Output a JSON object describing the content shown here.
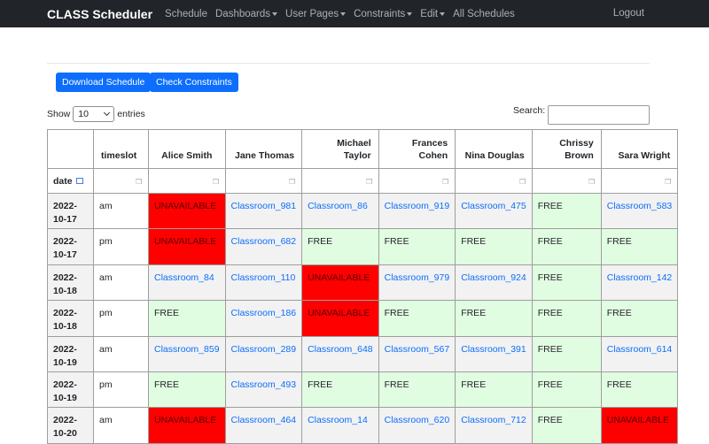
{
  "nav": {
    "brand": "CLASS Scheduler",
    "items": [
      {
        "label": "Schedule",
        "dropdown": false
      },
      {
        "label": "Dashboards",
        "dropdown": true
      },
      {
        "label": "User Pages",
        "dropdown": true
      },
      {
        "label": "Constraints",
        "dropdown": true
      },
      {
        "label": "Edit",
        "dropdown": true
      },
      {
        "label": "All Schedules",
        "dropdown": false
      }
    ],
    "logout": "Logout"
  },
  "buttons": {
    "download": "Download Schedule",
    "check": "Check Constraints"
  },
  "table_controls": {
    "show_label": "Show",
    "entries_value": "10",
    "entries_label": "entries",
    "search_label": "Search:"
  },
  "colors": {
    "navbar": "#212529",
    "primary": "#0d6efd",
    "free": "#e1fde1",
    "unavailable": "#ff0000"
  },
  "table": {
    "headers": [
      "timeslot",
      "Alice Smith",
      "Jane Thomas",
      "Michael Taylor",
      "Frances Cohen",
      "Nina Douglas",
      "Chrissy Brown",
      "Sara Wright"
    ],
    "filter_label": "date",
    "rows": [
      {
        "date": "2022-10-17",
        "slot": "am",
        "cells": [
          "UNAVAILABLE",
          "Classroom_981",
          "Classroom_86",
          "Classroom_919",
          "Classroom_475",
          "FREE",
          "Classroom_583"
        ]
      },
      {
        "date": "2022-10-17",
        "slot": "pm",
        "cells": [
          "UNAVAILABLE",
          "Classroom_682",
          "FREE",
          "FREE",
          "FREE",
          "FREE",
          "FREE"
        ]
      },
      {
        "date": "2022-10-18",
        "slot": "am",
        "cells": [
          "Classroom_84",
          "Classroom_110",
          "UNAVAILABLE",
          "Classroom_979",
          "Classroom_924",
          "FREE",
          "Classroom_142"
        ]
      },
      {
        "date": "2022-10-18",
        "slot": "pm",
        "cells": [
          "FREE",
          "Classroom_186",
          "UNAVAILABLE",
          "FREE",
          "FREE",
          "FREE",
          "FREE"
        ]
      },
      {
        "date": "2022-10-19",
        "slot": "am",
        "cells": [
          "Classroom_859",
          "Classroom_289",
          "Classroom_648",
          "Classroom_567",
          "Classroom_391",
          "FREE",
          "Classroom_614"
        ]
      },
      {
        "date": "2022-10-19",
        "slot": "pm",
        "cells": [
          "FREE",
          "Classroom_493",
          "FREE",
          "FREE",
          "FREE",
          "FREE",
          "FREE"
        ]
      },
      {
        "date": "2022-10-20",
        "slot": "am",
        "cells": [
          "UNAVAILABLE",
          "Classroom_464",
          "Classroom_14",
          "Classroom_620",
          "Classroom_712",
          "FREE",
          "UNAVAILABLE"
        ]
      }
    ]
  }
}
